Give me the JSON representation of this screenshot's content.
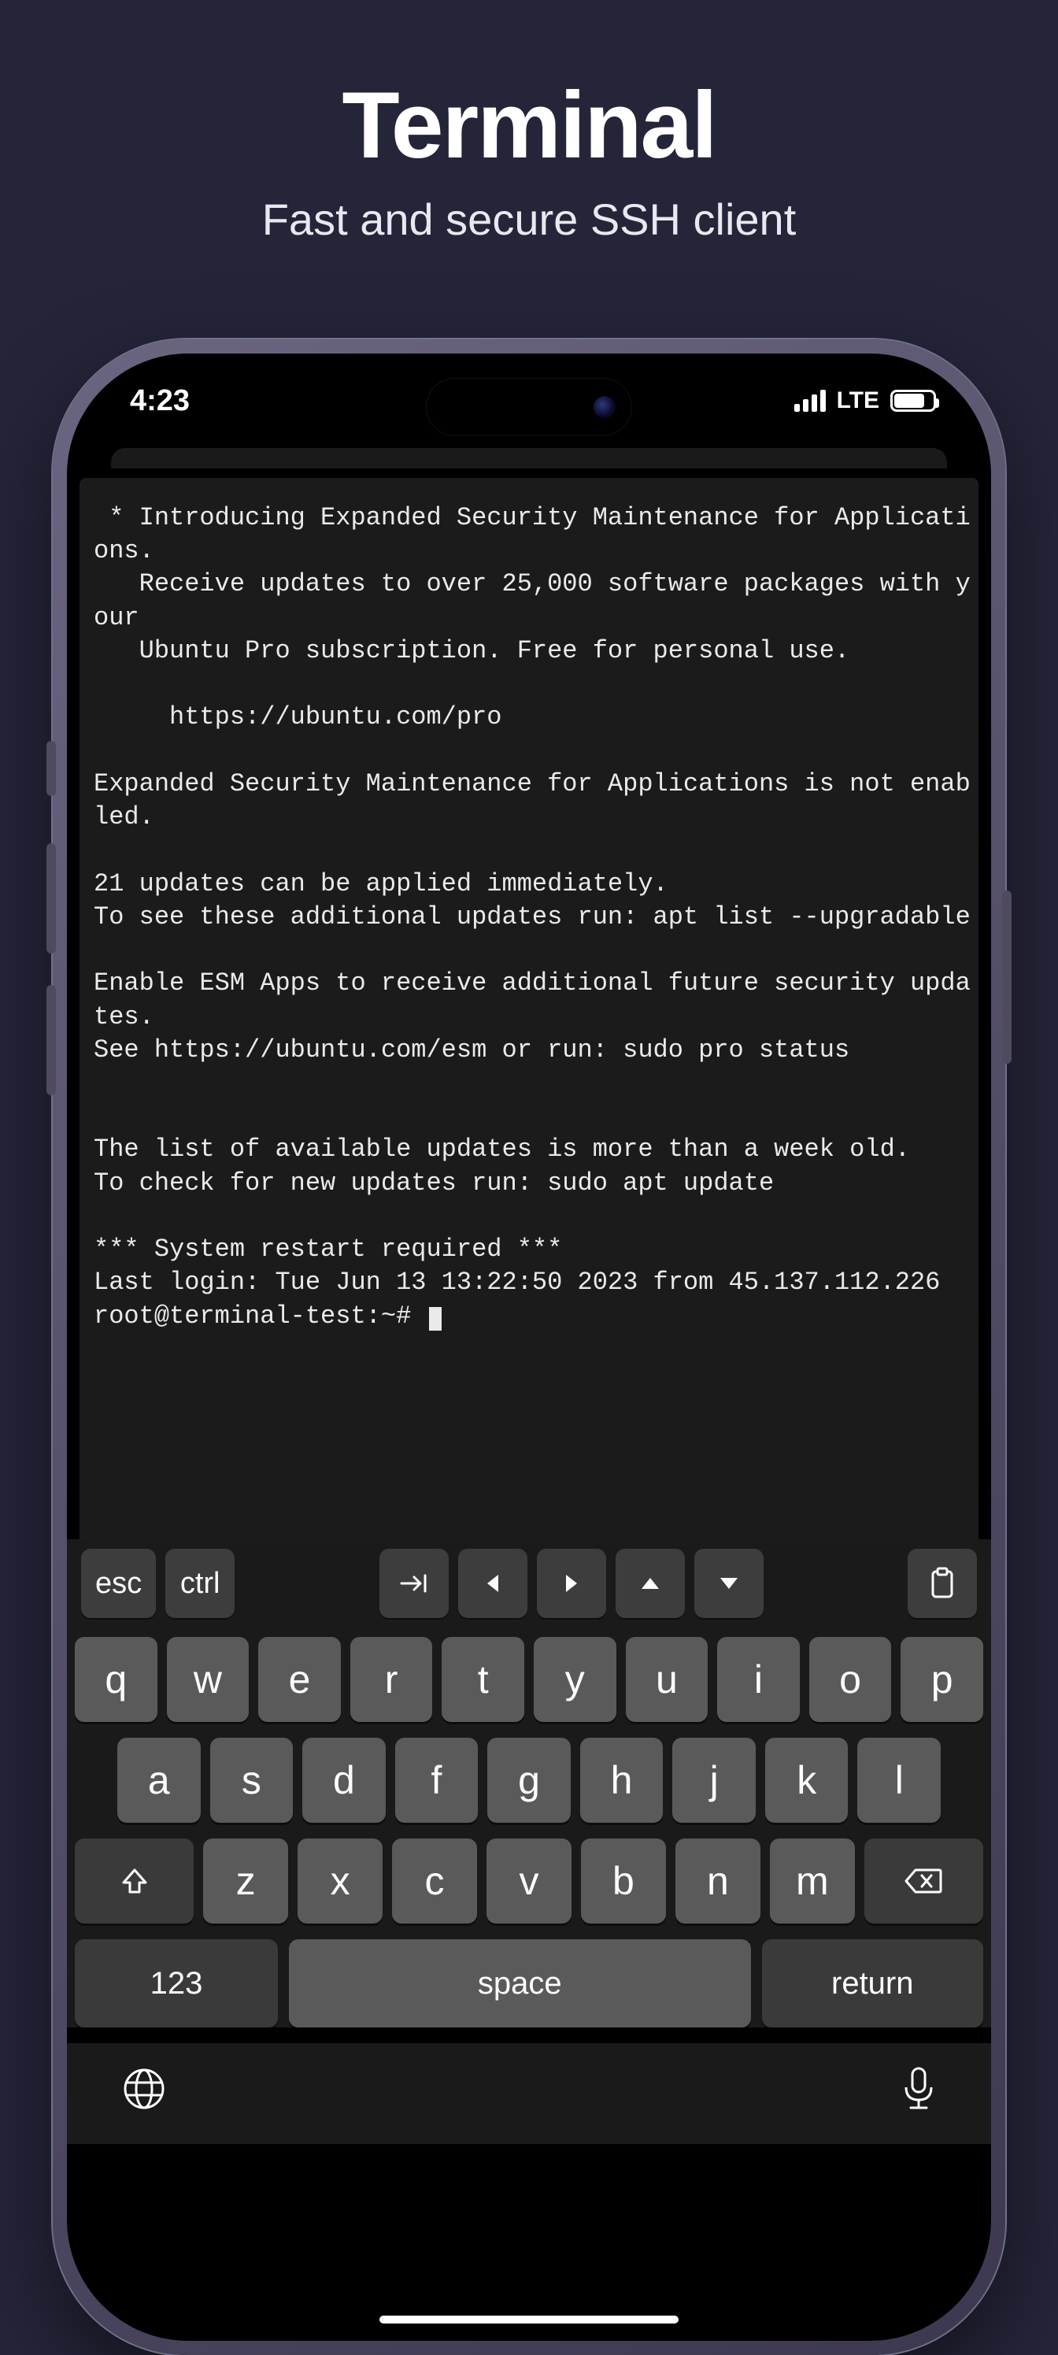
{
  "header": {
    "title": "Terminal",
    "subtitle": "Fast and secure SSH client"
  },
  "status": {
    "time": "4:23",
    "network": "LTE"
  },
  "terminal": {
    "text": " * Introducing Expanded Security Maintenance for Applications.\n   Receive updates to over 25,000 software packages with your\n   Ubuntu Pro subscription. Free for personal use.\n\n     https://ubuntu.com/pro\n\nExpanded Security Maintenance for Applications is not enabled.\n\n21 updates can be applied immediately.\nTo see these additional updates run: apt list --upgradable\n\nEnable ESM Apps to receive additional future security updates.\nSee https://ubuntu.com/esm or run: sudo pro status\n\n\nThe list of available updates is more than a week old.\nTo check for new updates run: sudo apt update\n\n*** System restart required ***\nLast login: Tue Jun 13 13:22:50 2023 from 45.137.112.226",
    "prompt": "root@terminal-test:~# "
  },
  "toolbar": {
    "esc": "esc",
    "ctrl": "ctrl"
  },
  "keyboard": {
    "row1": [
      "q",
      "w",
      "e",
      "r",
      "t",
      "y",
      "u",
      "i",
      "o",
      "p"
    ],
    "row2": [
      "a",
      "s",
      "d",
      "f",
      "g",
      "h",
      "j",
      "k",
      "l"
    ],
    "row3": [
      "z",
      "x",
      "c",
      "v",
      "b",
      "n",
      "m"
    ],
    "numKey": "123",
    "spaceKey": "space",
    "returnKey": "return"
  }
}
